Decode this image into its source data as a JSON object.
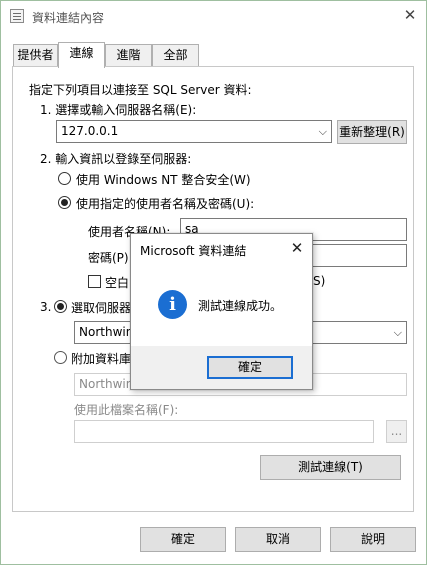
{
  "window": {
    "title": "資料連結內容",
    "close_glyph": "✕"
  },
  "tabs": [
    {
      "label": "提供者"
    },
    {
      "label": "連線"
    },
    {
      "label": "進階"
    },
    {
      "label": "全部"
    }
  ],
  "connection": {
    "intro": "指定下列項目以連接至 SQL Server 資料:",
    "step1_label": "1. 選擇或輸入伺服器名稱(E):",
    "server_value": "127.0.0.1",
    "refresh_button": "重新整理(R)",
    "step2_label": "2. 輸入資訊以登錄至伺服器:",
    "radio_windows": "使用 Windows NT 整合安全(W)",
    "radio_specific": "使用指定的使用者名稱及密碼(U):",
    "username_label": "使用者名稱(N):",
    "username_value": "sa",
    "password_label": "密碼(P):",
    "password_value": "",
    "blank_password_label": "空白",
    "allow_save_suffix": "S)",
    "step3_label": "3.",
    "radio_select_db": "選取伺服器",
    "database_value": "Northwin",
    "radio_attach": "附加資料庫",
    "attach_value": "Northwin",
    "filename_label": "使用此檔案名稱(F):",
    "browse_button": "...",
    "test_button": "測試連線(T)"
  },
  "footer": {
    "ok": "確定",
    "cancel": "取消",
    "help": "說明"
  },
  "message_dialog": {
    "title": "Microsoft 資料連結",
    "close_glyph": "✕",
    "icon_glyph": "i",
    "message": "測試連線成功。",
    "ok_button": "確定"
  }
}
